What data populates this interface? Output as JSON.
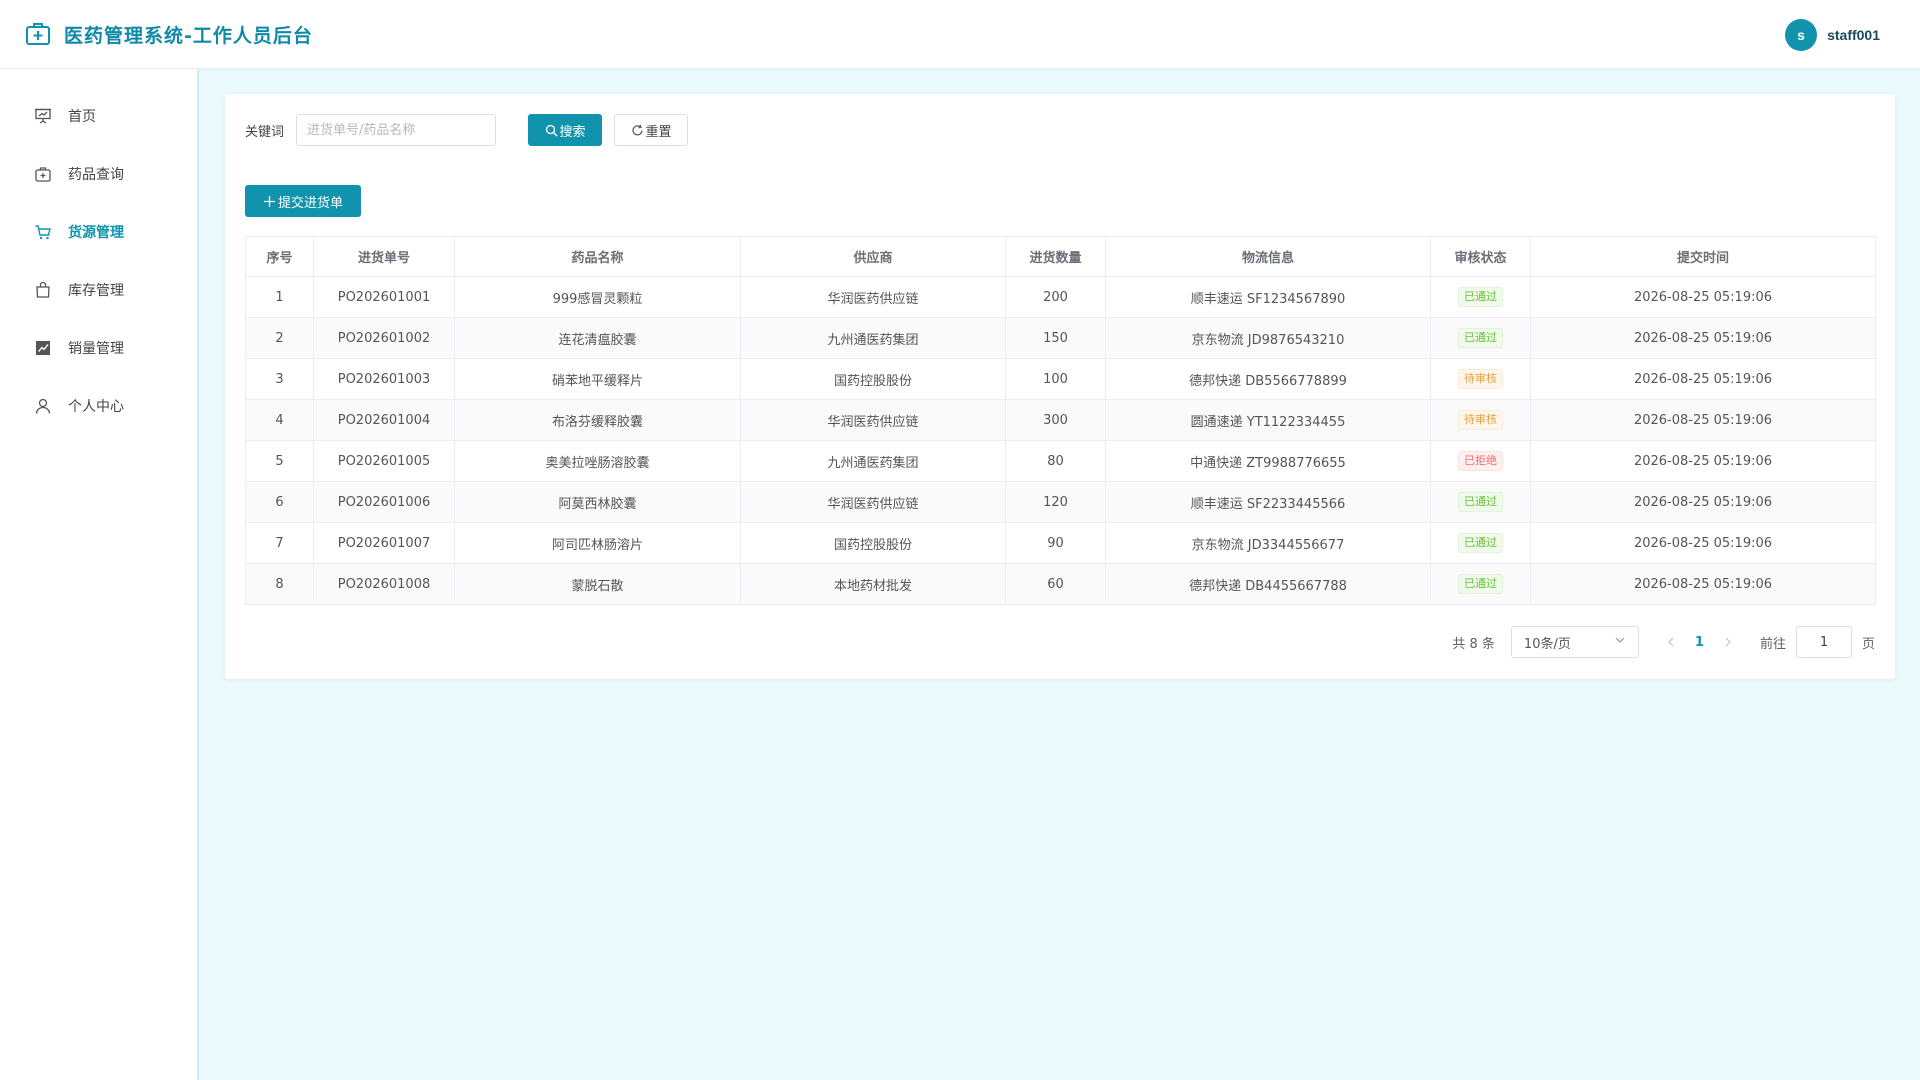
{
  "header": {
    "title": "医药管理系统-工作人员后台",
    "brand_icon": "medical-kit-icon",
    "user": {
      "avatar_letter": "s",
      "name": "staff001"
    }
  },
  "sidebar": {
    "items": [
      {
        "label": "首页",
        "icon": "presentation-chart-icon",
        "active": false
      },
      {
        "label": "药品查询",
        "icon": "medical-kit-icon",
        "active": false
      },
      {
        "label": "货源管理",
        "icon": "cart-icon",
        "active": true
      },
      {
        "label": "库存管理",
        "icon": "shopping-bag-icon",
        "active": false
      },
      {
        "label": "销量管理",
        "icon": "trend-chart-icon",
        "active": false
      },
      {
        "label": "个人中心",
        "icon": "user-icon",
        "active": false
      }
    ]
  },
  "search": {
    "label": "关键词",
    "placeholder": "进货单号/药品名称",
    "value": "",
    "search_button": "搜索",
    "reset_button": "重置"
  },
  "toolbar": {
    "add_button": "提交进货单"
  },
  "table": {
    "columns": [
      "序号",
      "进货单号",
      "药品名称",
      "供应商",
      "进货数量",
      "物流信息",
      "审核状态",
      "提交时间"
    ],
    "rows": [
      {
        "idx": "1",
        "order_no": "PO202601001",
        "drug": "999感冒灵颗粒",
        "supplier": "华润医药供应链",
        "qty": "200",
        "logistics": "顺丰速运 SF1234567890",
        "status": "已通过",
        "status_type": "ok",
        "time": "2026-08-25 05:19:06"
      },
      {
        "idx": "2",
        "order_no": "PO202601002",
        "drug": "连花清瘟胶囊",
        "supplier": "九州通医药集团",
        "qty": "150",
        "logistics": "京东物流 JD9876543210",
        "status": "已通过",
        "status_type": "ok",
        "time": "2026-08-25 05:19:06"
      },
      {
        "idx": "3",
        "order_no": "PO202601003",
        "drug": "硝苯地平缓释片",
        "supplier": "国药控股股份",
        "qty": "100",
        "logistics": "德邦快递 DB5566778899",
        "status": "待审核",
        "status_type": "wait",
        "time": "2026-08-25 05:19:06"
      },
      {
        "idx": "4",
        "order_no": "PO202601004",
        "drug": "布洛芬缓释胶囊",
        "supplier": "华润医药供应链",
        "qty": "300",
        "logistics": "圆通速递 YT1122334455",
        "status": "待审核",
        "status_type": "wait",
        "time": "2026-08-25 05:19:06"
      },
      {
        "idx": "5",
        "order_no": "PO202601005",
        "drug": "奥美拉唑肠溶胶囊",
        "supplier": "九州通医药集团",
        "qty": "80",
        "logistics": "中通快递 ZT9988776655",
        "status": "已拒绝",
        "status_type": "rej",
        "time": "2026-08-25 05:19:06"
      },
      {
        "idx": "6",
        "order_no": "PO202601006",
        "drug": "阿莫西林胶囊",
        "supplier": "华润医药供应链",
        "qty": "120",
        "logistics": "顺丰速运 SF2233445566",
        "status": "已通过",
        "status_type": "ok",
        "time": "2026-08-25 05:19:06"
      },
      {
        "idx": "7",
        "order_no": "PO202601007",
        "drug": "阿司匹林肠溶片",
        "supplier": "国药控股股份",
        "qty": "90",
        "logistics": "京东物流 JD3344556677",
        "status": "已通过",
        "status_type": "ok",
        "time": "2026-08-25 05:19:06"
      },
      {
        "idx": "8",
        "order_no": "PO202601008",
        "drug": "蒙脱石散",
        "supplier": "本地药材批发",
        "qty": "60",
        "logistics": "德邦快递 DB4455667788",
        "status": "已通过",
        "status_type": "ok",
        "time": "2026-08-25 05:19:06"
      }
    ]
  },
  "pagination": {
    "total": "共 8 条",
    "page_size": "10条/页",
    "current_page": "1",
    "goto_label": "前往",
    "goto_value": "1",
    "page_suffix": "页"
  },
  "colors": {
    "primary": "#1193ad",
    "background": "#eafafd",
    "status_ok": "#67c23a",
    "status_wait": "#e6a23c",
    "status_rej": "#f56c6c"
  }
}
